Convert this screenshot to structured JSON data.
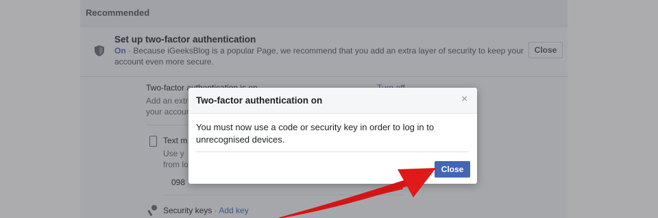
{
  "section": {
    "title": "Recommended"
  },
  "recommendation": {
    "title": "Set up two-factor authentication",
    "status": "On",
    "description": " · Because iGeeksBlog is a popular Page, we recommend that you add an extra layer of security to keep your account even more secure.",
    "close_label": "Close"
  },
  "settings": {
    "status_line": "Two-factor authentication is on",
    "turn_off_label": "Turn off",
    "desc_line1": "Add an extra",
    "desc_line2": "your account",
    "text_message_label": "Text m",
    "text_message_desc1": "Use y",
    "text_message_desc2": "from lo",
    "phone_fragment": "098",
    "security_keys_label": "Security keys",
    "add_key_label": "Add key",
    "separator": " · "
  },
  "modal": {
    "title": "Two-factor authentication on",
    "close_x": "×",
    "body": "You must now use a code or security key in order to log in to unrecognised devices.",
    "close_label": "Close"
  },
  "colors": {
    "accent": "#4267b2",
    "arrow": "#e01919"
  }
}
